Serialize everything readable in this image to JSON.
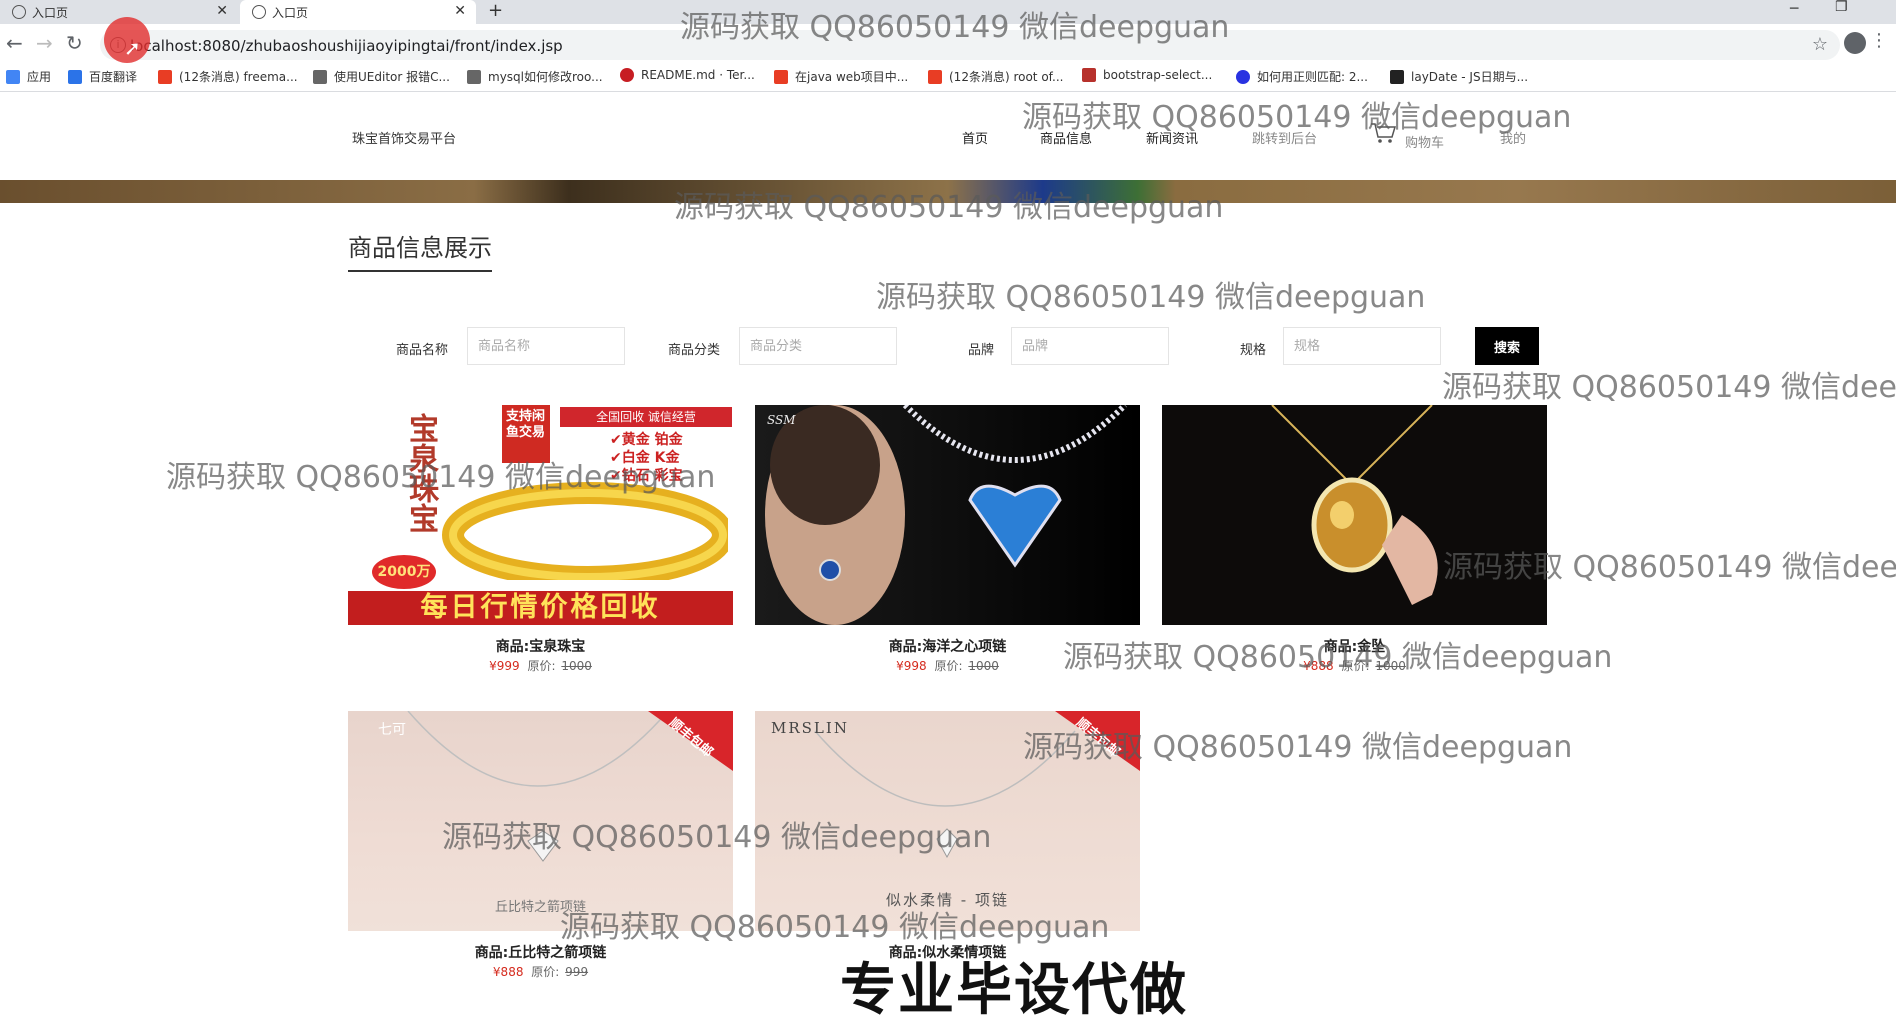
{
  "browser": {
    "tabs": [
      {
        "label": "入口页"
      },
      {
        "label": "入口页"
      }
    ],
    "new_tab": "+",
    "url": "localhost:8080/zhubaoshoushijiaoyipingtai/front/index.jsp",
    "bookmarks": [
      {
        "label": "应用",
        "icon": "apps-grid-icon",
        "color": "#4285f4"
      },
      {
        "label": "百度翻译",
        "icon": "baidu-translate-icon",
        "color": "#2b73e8"
      },
      {
        "label": "(12条消息) freema...",
        "icon": "csdn-icon",
        "color": "#e83d24"
      },
      {
        "label": "使用UEditor 报错C...",
        "icon": "feather-icon",
        "color": "#666666"
      },
      {
        "label": "mysql如何修改roo...",
        "icon": "feather-icon",
        "color": "#666666"
      },
      {
        "label": "README.md · Ter...",
        "icon": "gitee-icon",
        "color": "#c71d23"
      },
      {
        "label": "在java web项目中...",
        "icon": "csdn-icon",
        "color": "#e83d24"
      },
      {
        "label": "(12条消息) root of...",
        "icon": "csdn-icon",
        "color": "#e83d24"
      },
      {
        "label": "bootstrap-select...",
        "icon": "cnblogs-icon",
        "color": "#b7312c"
      },
      {
        "label": "如何用正则匹配: 2...",
        "icon": "baidu-paw-icon",
        "color": "#2932e1"
      },
      {
        "label": "layDate - JS日期与...",
        "icon": "laydate-icon",
        "color": "#222222"
      }
    ]
  },
  "header": {
    "brand": "珠宝首饰交易平台",
    "nav": [
      "首页",
      "商品信息",
      "新闻资讯",
      "跳转到后台",
      "购物车",
      "我的"
    ]
  },
  "section": {
    "title": "商品信息展示"
  },
  "filters": [
    {
      "label": "商品名称",
      "placeholder": "商品名称"
    },
    {
      "label": "商品分类",
      "placeholder": "商品分类"
    },
    {
      "label": "品牌",
      "placeholder": "品牌"
    },
    {
      "label": "规格",
      "placeholder": "规格"
    }
  ],
  "search_button": "搜索",
  "products": [
    {
      "name": "商品:宝泉珠宝",
      "price": "¥999",
      "orig_label": "原价:",
      "orig_price": "1000",
      "image_text": {
        "top_tag": "全国回收 诚信经营",
        "side": "宝泉珠宝",
        "badge": "支持闲鱼交易",
        "bullets": [
          "✔黄金 铂金",
          "✔白金 K金",
          "✔钻石 彩宝"
        ],
        "bottom": "每日行情价格回收",
        "stamp": "2000万"
      }
    },
    {
      "name": "商品:海洋之心项链",
      "price": "¥998",
      "orig_label": "原价:",
      "orig_price": "1000",
      "image_text": {
        "brand": "SSM"
      }
    },
    {
      "name": "商品:金坠",
      "price": "¥888",
      "orig_label": "原价:",
      "orig_price": "1000",
      "image_text": {}
    },
    {
      "name": "商品:丘比特之箭项链",
      "price": "¥888",
      "orig_label": "原价:",
      "orig_price": "999",
      "image_text": {
        "brand": "七可",
        "ribbon": "顺丰包邮",
        "caption": "丘比特之箭项链"
      }
    },
    {
      "name": "商品:似水柔情项链",
      "price": "",
      "orig_label": "",
      "orig_price": "",
      "image_text": {
        "brand": "MRSLIN",
        "ribbon": "顺丰包邮",
        "caption": "似水柔情 - 项链"
      }
    }
  ],
  "overlays": {
    "watermark": "源码获取 QQ86050149 微信deepguan",
    "watermark_cut": "源码获取 QQ86050149 微信deep",
    "caption": "专业毕设代做"
  }
}
